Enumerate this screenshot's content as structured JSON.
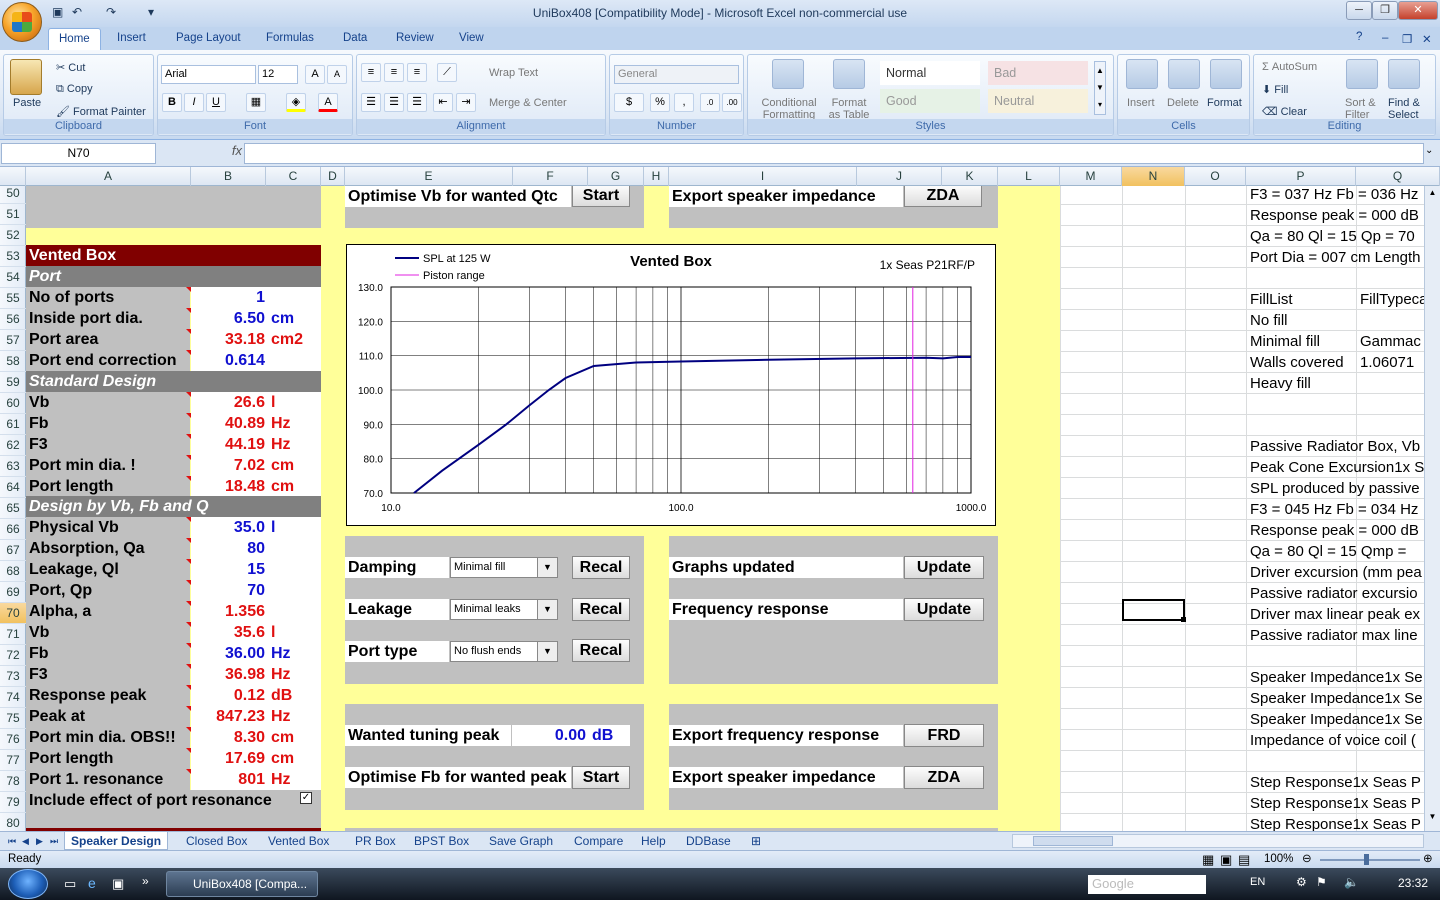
{
  "window": {
    "title": "UniBox408  [Compatibility Mode] - Microsoft Excel non-commercial use"
  },
  "ribbon": {
    "tabs": [
      "Home",
      "Insert",
      "Page Layout",
      "Formulas",
      "Data",
      "Review",
      "View"
    ],
    "clipboard": {
      "paste": "Paste",
      "cut": "Cut",
      "copy": "Copy",
      "format_painter": "Format Painter",
      "label": "Clipboard"
    },
    "font": {
      "name": "Arial",
      "size": "12",
      "label": "Font",
      "bold": "B",
      "italic": "I",
      "underline": "U"
    },
    "alignment": {
      "wrap": "Wrap Text",
      "merge": "Merge & Center",
      "label": "Alignment"
    },
    "number": {
      "format": "General",
      "label": "Number",
      "percent": "%",
      "comma": ","
    },
    "styles": {
      "conditional": "Conditional",
      "conditional2": "Formatting",
      "format_table": "Format",
      "format_table2": "as Table",
      "normal": "Normal",
      "bad": "Bad",
      "good": "Good",
      "neutral": "Neutral",
      "label": "Styles"
    },
    "cells": {
      "insert": "Insert",
      "delete": "Delete",
      "format": "Format",
      "label": "Cells"
    },
    "editing": {
      "autosum": "AutoSum",
      "fill": "Fill",
      "clear": "Clear",
      "sort": "Sort &",
      "sort2": "Filter",
      "find": "Find &",
      "find2": "Select",
      "label": "Editing"
    }
  },
  "formula_bar": {
    "name_box": "N70",
    "fx": "fx",
    "content": ""
  },
  "columns": [
    "A",
    "B",
    "C",
    "D",
    "E",
    "F",
    "G",
    "H",
    "I",
    "J",
    "K",
    "L",
    "M",
    "N",
    "O",
    "P",
    "Q"
  ],
  "rows": [
    "50",
    "51",
    "52",
    "53",
    "54",
    "55",
    "56",
    "57",
    "58",
    "59",
    "60",
    "61",
    "62",
    "63",
    "64",
    "65",
    "66",
    "67",
    "68",
    "69",
    "70",
    "71",
    "72",
    "73",
    "74",
    "75",
    "76",
    "77",
    "78",
    "79",
    "80"
  ],
  "left_panel": {
    "title": "Vented Box",
    "section_port": "Port",
    "port_rows": [
      {
        "label": "No of ports",
        "value": "1",
        "unit": "",
        "color": "blue"
      },
      {
        "label": "Inside port dia.",
        "value": "6.50",
        "unit": "cm",
        "color": "blue"
      },
      {
        "label": "Port area",
        "value": "33.18",
        "unit": "cm2",
        "color": "red"
      },
      {
        "label": "Port end correction",
        "value": "0.614",
        "unit": "",
        "color": "blue"
      }
    ],
    "section_std": "Standard Design",
    "std_rows": [
      {
        "label": "Vb",
        "value": "26.6",
        "unit": "l",
        "color": "red"
      },
      {
        "label": "Fb",
        "value": "40.89",
        "unit": "Hz",
        "color": "red"
      },
      {
        "label": "F3",
        "value": "44.19",
        "unit": "Hz",
        "color": "red"
      },
      {
        "label": "Port min dia. !",
        "value": "7.02",
        "unit": "cm",
        "color": "red"
      },
      {
        "label": "Port length",
        "value": "18.48",
        "unit": "cm",
        "color": "red"
      }
    ],
    "section_design": "Design by Vb, Fb and Q",
    "design_rows": [
      {
        "label": "Physical Vb",
        "value": "35.0",
        "unit": "l",
        "color": "blue"
      },
      {
        "label": "Absorption, Qa",
        "value": "80",
        "unit": "",
        "color": "blue"
      },
      {
        "label": "Leakage, Ql",
        "value": "15",
        "unit": "",
        "color": "blue"
      },
      {
        "label": "Port, Qp",
        "value": "70",
        "unit": "",
        "color": "blue"
      },
      {
        "label": "Alpha, a",
        "value": "1.356",
        "unit": "",
        "color": "red"
      },
      {
        "label": "Vb",
        "value": "35.6",
        "unit": "l",
        "color": "red"
      },
      {
        "label": "Fb",
        "value": "36.00",
        "unit": "Hz",
        "color": "blue"
      },
      {
        "label": "F3",
        "value": "36.98",
        "unit": "Hz",
        "color": "red"
      },
      {
        "label": "Response peak",
        "value": "0.12",
        "unit": "dB",
        "color": "red"
      },
      {
        "label": "Peak at",
        "value": "847.23",
        "unit": "Hz",
        "color": "red"
      },
      {
        "label": "Port min dia. OBS!!",
        "value": "8.30",
        "unit": "cm",
        "color": "red"
      },
      {
        "label": "Port length",
        "value": "17.69",
        "unit": "cm",
        "color": "red"
      },
      {
        "label": "Port 1. resonance",
        "value": "801",
        "unit": "Hz",
        "color": "red"
      }
    ],
    "include_label": "Include effect of port resonance",
    "include_checked": "✓"
  },
  "center": {
    "opt_vb": "Optimise Vb for wanted Qtc",
    "start": "Start",
    "export_imp": "Export speaker impedance",
    "zda": "ZDA",
    "damping": "Damping",
    "damping_val": "Minimal fill",
    "leakage": "Leakage",
    "leakage_val": "Minimal leaks",
    "port_type": "Port type",
    "port_type_val": "No flush ends",
    "recal": "Recal",
    "graphs_updated": "Graphs updated",
    "freq_resp": "Frequency response",
    "update": "Update",
    "wanted_peak": "Wanted tuning peak",
    "wanted_peak_val": "0.00",
    "wanted_peak_unit": "dB",
    "export_freq": "Export frequency response",
    "frd": "FRD",
    "opt_fb": "Optimise Fb for wanted peak"
  },
  "right_text": {
    "p50": "F3 = 037 Hz  Fb = 036 Hz",
    "p51": "Response peak = 000 dB",
    "p52": "Qa = 80  Ql = 15  Qp = 70",
    "p53": "Port Dia = 007 cm  Length",
    "p55": "FillList",
    "q55": "FillTypeca",
    "p56": "No fill",
    "p57": "Minimal fill",
    "q57": "Gammac",
    "p58": "Walls covered",
    "q58": "1.06071",
    "p59": "Heavy fill",
    "p62": "Passive Radiator Box, Vb",
    "p63": "Peak Cone Excursion1x S",
    "p64": "SPL produced by passive",
    "p65": "F3 = 045 Hz  Fb = 034 Hz",
    "p66": "Response peak = 000 dB",
    "p67": "Qa = 80  Ql = 15  Qmp =",
    "p68": "Driver excursion (mm pea",
    "p69": "Passive radiator excursio",
    "p70": "Driver max linear peak ex",
    "p71": "Passive radiator max line",
    "p73": "Speaker Impedance1x Se",
    "p74": "Speaker Impedance1x Se",
    "p75": "Speaker Impedance1x Se",
    "p76": "Impedance of voice coil (",
    "p78": "Step Response1x Seas P",
    "p79": "Step Response1x Seas P",
    "p80": "Step Response1x Seas P"
  },
  "chart_data": {
    "type": "line",
    "title": "Vented Box",
    "subtitle": "1x Seas P21RF/P",
    "x_scale": "log",
    "xlim": [
      10,
      1000
    ],
    "ylim": [
      70,
      130
    ],
    "x_ticks": [
      "10.0",
      "100.0",
      "1000.0"
    ],
    "y_ticks": [
      "70.0",
      "80.0",
      "90.0",
      "100.0",
      "110.0",
      "120.0",
      "130.0"
    ],
    "grid": true,
    "legend_position": "top-left",
    "series": [
      {
        "name": "SPL at 125 W",
        "color": "#000080",
        "x": [
          12,
          15,
          20,
          25,
          30,
          35,
          40,
          50,
          70,
          100,
          200,
          400,
          700,
          800,
          900,
          1000
        ],
        "y": [
          70,
          76.5,
          84,
          90,
          95.5,
          100,
          103.5,
          107,
          108,
          108.3,
          108.8,
          109.2,
          109.4,
          109.2,
          109.6,
          109.6
        ]
      },
      {
        "name": "Piston range",
        "color": "#e020e0",
        "x": [
          630,
          630
        ],
        "y": [
          70,
          130
        ]
      }
    ]
  },
  "sheet_tabs": [
    "Speaker Design",
    "Closed Box",
    "Vented Box",
    "PR Box",
    "BPST Box",
    "Save Graph",
    "Compare",
    "Help",
    "DDBase"
  ],
  "status": {
    "ready": "Ready",
    "zoom": "100%"
  },
  "taskbar": {
    "app": "UniBox408  [Compa...",
    "lang": "EN",
    "time": "23:32",
    "search": "Google"
  }
}
